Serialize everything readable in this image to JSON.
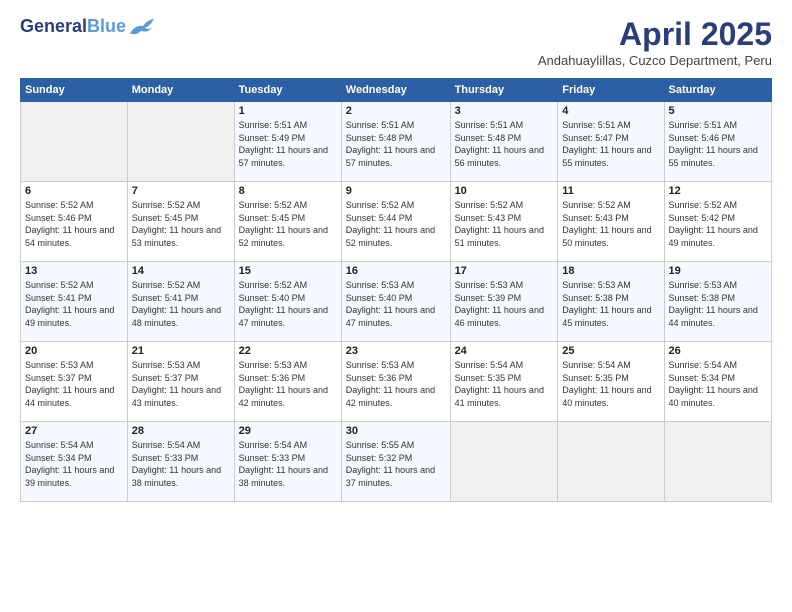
{
  "header": {
    "logo_line1": "General",
    "logo_line2": "Blue",
    "month": "April 2025",
    "location": "Andahuaylillas, Cuzco Department, Peru"
  },
  "weekdays": [
    "Sunday",
    "Monday",
    "Tuesday",
    "Wednesday",
    "Thursday",
    "Friday",
    "Saturday"
  ],
  "weeks": [
    [
      {
        "day": "",
        "info": ""
      },
      {
        "day": "",
        "info": ""
      },
      {
        "day": "1",
        "info": "Sunrise: 5:51 AM\nSunset: 5:49 PM\nDaylight: 11 hours and 57 minutes."
      },
      {
        "day": "2",
        "info": "Sunrise: 5:51 AM\nSunset: 5:48 PM\nDaylight: 11 hours and 57 minutes."
      },
      {
        "day": "3",
        "info": "Sunrise: 5:51 AM\nSunset: 5:48 PM\nDaylight: 11 hours and 56 minutes."
      },
      {
        "day": "4",
        "info": "Sunrise: 5:51 AM\nSunset: 5:47 PM\nDaylight: 11 hours and 55 minutes."
      },
      {
        "day": "5",
        "info": "Sunrise: 5:51 AM\nSunset: 5:46 PM\nDaylight: 11 hours and 55 minutes."
      }
    ],
    [
      {
        "day": "6",
        "info": "Sunrise: 5:52 AM\nSunset: 5:46 PM\nDaylight: 11 hours and 54 minutes."
      },
      {
        "day": "7",
        "info": "Sunrise: 5:52 AM\nSunset: 5:45 PM\nDaylight: 11 hours and 53 minutes."
      },
      {
        "day": "8",
        "info": "Sunrise: 5:52 AM\nSunset: 5:45 PM\nDaylight: 11 hours and 52 minutes."
      },
      {
        "day": "9",
        "info": "Sunrise: 5:52 AM\nSunset: 5:44 PM\nDaylight: 11 hours and 52 minutes."
      },
      {
        "day": "10",
        "info": "Sunrise: 5:52 AM\nSunset: 5:43 PM\nDaylight: 11 hours and 51 minutes."
      },
      {
        "day": "11",
        "info": "Sunrise: 5:52 AM\nSunset: 5:43 PM\nDaylight: 11 hours and 50 minutes."
      },
      {
        "day": "12",
        "info": "Sunrise: 5:52 AM\nSunset: 5:42 PM\nDaylight: 11 hours and 49 minutes."
      }
    ],
    [
      {
        "day": "13",
        "info": "Sunrise: 5:52 AM\nSunset: 5:41 PM\nDaylight: 11 hours and 49 minutes."
      },
      {
        "day": "14",
        "info": "Sunrise: 5:52 AM\nSunset: 5:41 PM\nDaylight: 11 hours and 48 minutes."
      },
      {
        "day": "15",
        "info": "Sunrise: 5:52 AM\nSunset: 5:40 PM\nDaylight: 11 hours and 47 minutes."
      },
      {
        "day": "16",
        "info": "Sunrise: 5:53 AM\nSunset: 5:40 PM\nDaylight: 11 hours and 47 minutes."
      },
      {
        "day": "17",
        "info": "Sunrise: 5:53 AM\nSunset: 5:39 PM\nDaylight: 11 hours and 46 minutes."
      },
      {
        "day": "18",
        "info": "Sunrise: 5:53 AM\nSunset: 5:38 PM\nDaylight: 11 hours and 45 minutes."
      },
      {
        "day": "19",
        "info": "Sunrise: 5:53 AM\nSunset: 5:38 PM\nDaylight: 11 hours and 44 minutes."
      }
    ],
    [
      {
        "day": "20",
        "info": "Sunrise: 5:53 AM\nSunset: 5:37 PM\nDaylight: 11 hours and 44 minutes."
      },
      {
        "day": "21",
        "info": "Sunrise: 5:53 AM\nSunset: 5:37 PM\nDaylight: 11 hours and 43 minutes."
      },
      {
        "day": "22",
        "info": "Sunrise: 5:53 AM\nSunset: 5:36 PM\nDaylight: 11 hours and 42 minutes."
      },
      {
        "day": "23",
        "info": "Sunrise: 5:53 AM\nSunset: 5:36 PM\nDaylight: 11 hours and 42 minutes."
      },
      {
        "day": "24",
        "info": "Sunrise: 5:54 AM\nSunset: 5:35 PM\nDaylight: 11 hours and 41 minutes."
      },
      {
        "day": "25",
        "info": "Sunrise: 5:54 AM\nSunset: 5:35 PM\nDaylight: 11 hours and 40 minutes."
      },
      {
        "day": "26",
        "info": "Sunrise: 5:54 AM\nSunset: 5:34 PM\nDaylight: 11 hours and 40 minutes."
      }
    ],
    [
      {
        "day": "27",
        "info": "Sunrise: 5:54 AM\nSunset: 5:34 PM\nDaylight: 11 hours and 39 minutes."
      },
      {
        "day": "28",
        "info": "Sunrise: 5:54 AM\nSunset: 5:33 PM\nDaylight: 11 hours and 38 minutes."
      },
      {
        "day": "29",
        "info": "Sunrise: 5:54 AM\nSunset: 5:33 PM\nDaylight: 11 hours and 38 minutes."
      },
      {
        "day": "30",
        "info": "Sunrise: 5:55 AM\nSunset: 5:32 PM\nDaylight: 11 hours and 37 minutes."
      },
      {
        "day": "",
        "info": ""
      },
      {
        "day": "",
        "info": ""
      },
      {
        "day": "",
        "info": ""
      }
    ]
  ]
}
